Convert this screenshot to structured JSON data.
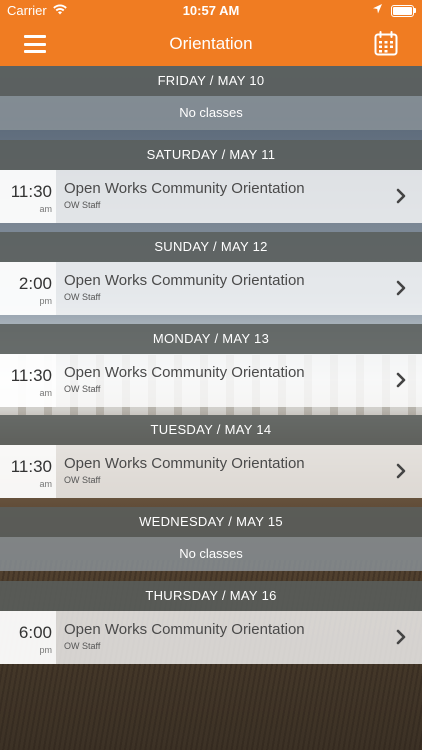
{
  "status_bar": {
    "carrier": "Carrier",
    "time": "10:57 AM"
  },
  "nav": {
    "title": "Orientation",
    "menu_icon": "hamburger-menu-icon",
    "calendar_icon": "calendar-icon"
  },
  "colors": {
    "brand_orange": "#f07c22",
    "header_gray": "#5a5e5c",
    "no_class_gray": "#8a9398"
  },
  "days": [
    {
      "header": "FRIDAY / MAY 10",
      "no_classes": "No classes"
    },
    {
      "header": "SATURDAY / MAY 11",
      "classes": [
        {
          "time": "11:30",
          "ampm": "am",
          "name": "Open Works Community Orientation",
          "instructor": "OW Staff"
        }
      ]
    },
    {
      "header": "SUNDAY / MAY 12",
      "classes": [
        {
          "time": "2:00",
          "ampm": "pm",
          "name": "Open Works Community Orientation",
          "instructor": "OW Staff"
        }
      ]
    },
    {
      "header": "MONDAY / MAY 13",
      "classes": [
        {
          "time": "11:30",
          "ampm": "am",
          "name": "Open Works Community Orientation",
          "instructor": "OW Staff"
        }
      ]
    },
    {
      "header": "TUESDAY / MAY 14",
      "classes": [
        {
          "time": "11:30",
          "ampm": "am",
          "name": "Open Works Community Orientation",
          "instructor": "OW Staff"
        }
      ]
    },
    {
      "header": "WEDNESDAY / MAY 15",
      "no_classes": "No classes"
    },
    {
      "header": "THURSDAY / MAY 16",
      "classes": [
        {
          "time": "6:00",
          "ampm": "pm",
          "name": "Open Works Community Orientation",
          "instructor": "OW Staff"
        }
      ]
    }
  ]
}
